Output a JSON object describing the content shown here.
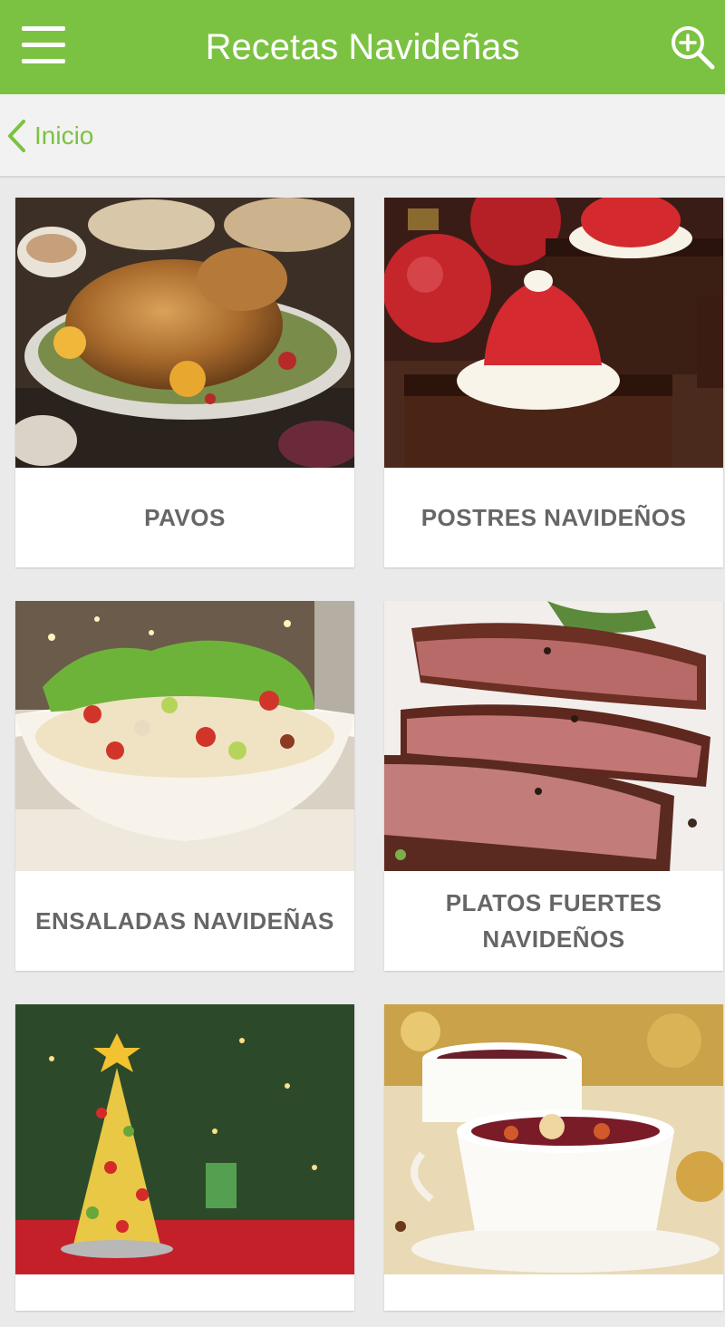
{
  "header": {
    "title": "Recetas Navideñas",
    "menu_icon": "hamburger-menu-icon",
    "search_icon": "zoom-in-search-icon",
    "color": "#7cc242"
  },
  "breadcrumb": {
    "back_label": "Inicio",
    "back_icon": "chevron-left-icon"
  },
  "categories": [
    {
      "label": "PAVOS",
      "image": "roast-turkey"
    },
    {
      "label": "POSTRES NAVIDEÑOS",
      "image": "strawberry-santa-hat-brownies"
    },
    {
      "label": "ENSALADAS NAVIDEÑAS",
      "image": "christmas-salad-bowl"
    },
    {
      "label": "PLATOS FUERTES NAVIDEÑOS",
      "image": "sliced-roast-beef"
    },
    {
      "label": "",
      "image": "fruit-christmas-tree"
    },
    {
      "label": "",
      "image": "mulled-wine-cups"
    }
  ]
}
